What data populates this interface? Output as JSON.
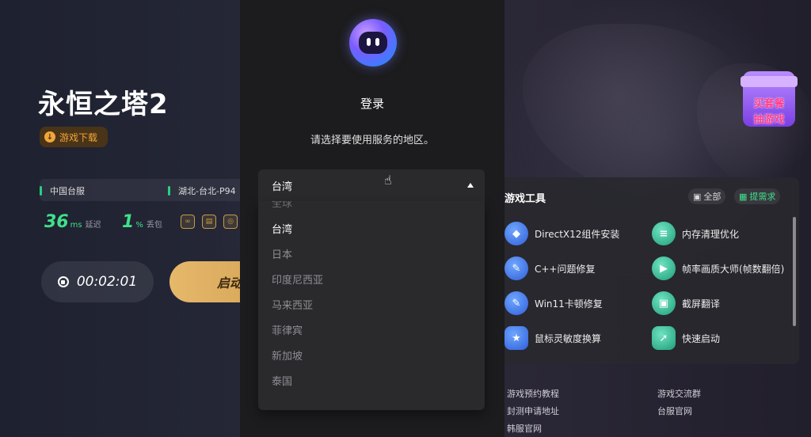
{
  "game": {
    "title": "永恒之塔2",
    "download_label": "游戏下载",
    "server_region": "中国台服",
    "server_node": "湖北-台北-P94",
    "latency_value": "36",
    "latency_unit": "ms",
    "latency_label": "延迟",
    "loss_value": "1",
    "loss_unit": "%",
    "loss_label": "丢包",
    "timer": "00:02:01",
    "start_label": "启动"
  },
  "login": {
    "title": "登录",
    "subtitle": "请选择要使用服务的地区。",
    "selected_region": "台湾",
    "options_partial": "全球",
    "options": [
      "台湾",
      "日本",
      "印度尼西亚",
      "马来西亚",
      "菲律宾",
      "新加坡",
      "泰国"
    ]
  },
  "tools": {
    "title": "游戏工具",
    "all_label": "全部",
    "request_label": "提需求",
    "items": [
      {
        "label": "DirectX12组件安装",
        "icon": "directx-icon"
      },
      {
        "label": "内存清理优化",
        "icon": "memory-clean-icon"
      },
      {
        "label": "C++问题修复",
        "icon": "wrench-icon"
      },
      {
        "label": "帧率画质大师(帧数翻倍)",
        "icon": "fps-icon"
      },
      {
        "label": "Win11卡顿修复",
        "icon": "wrench-icon"
      },
      {
        "label": "截屏翻译",
        "icon": "screenshot-translate-icon"
      },
      {
        "label": "鼠标灵敏度换算",
        "icon": "mouse-icon"
      },
      {
        "label": "快速启动",
        "icon": "quick-launch-icon"
      }
    ]
  },
  "promo": {
    "line1": "买套餐",
    "line2": "抽游戏"
  },
  "links": [
    "游戏预约教程",
    "封测申请地址",
    "韩服官网",
    "游戏交流群",
    "台服官网"
  ],
  "colors": {
    "accent_green": "#3fe08a",
    "accent_gold": "#e6b86a",
    "download_orange": "#f2a63a"
  }
}
